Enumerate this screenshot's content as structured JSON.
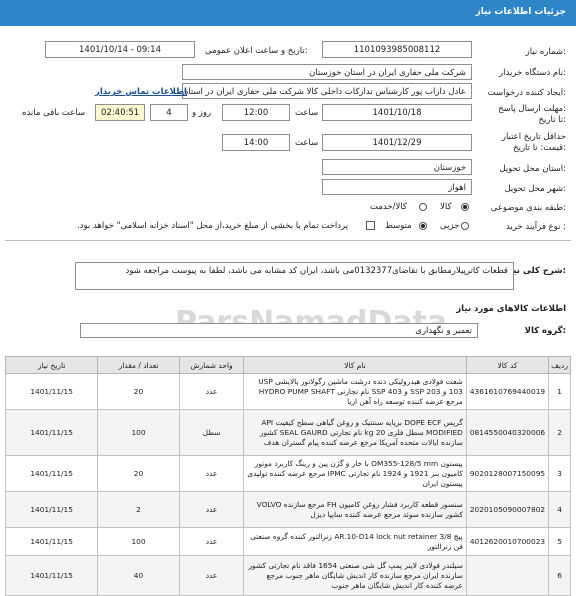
{
  "titlebar": {
    "title": "جزئیات اطلاعات نیاز"
  },
  "fields": {
    "need_number_label": "شماره نیاز:",
    "need_number": "1101093985008112",
    "announce_label": "تاریخ و ساعت اعلان عمومی:",
    "announce_value": "1401/10/14 - 09:14",
    "buyer_label": "نام دستگاه خریدار:",
    "buyer_value": "شرکت ملی حفاری ایران در استان خوزستان",
    "creator_label": "ایجاد کننده درخواست:",
    "creator_value": "عادل داراب پور کارشناس تدارکات داخلی کالا شرکت ملی حفاری ایران در استان",
    "contact_link": "اطلاعات تماس خریدار",
    "deadline_label": "مهلت ارسال پاسخ:",
    "deadline_until": "تا تاریخ:",
    "deadline_date": "1401/10/18",
    "hour_label": "ساعت",
    "deadline_time": "12:00",
    "days_value": "4",
    "days_label": "روز و",
    "remaining_time": "02:40:51",
    "remaining_label": "ساعت باقی مانده",
    "min_price_label": "حداقل تاریخ اعتبار",
    "min_price_label2": "قیمت: تا تاریخ:",
    "validity_date": "1401/12/29",
    "validity_time": "14:00",
    "province_label": "استان محل تحویل:",
    "province_value": "خوزستان",
    "city_label": "شهر محل تحویل:",
    "city_value": "اهواز",
    "category_label": "طبقه بندی موضوعی:",
    "category_opt1": "کالا",
    "category_opt2": "کالا/خدمت",
    "purchase_label": "نوع فرآیند خرید :",
    "purchase_opt1": "جزیی",
    "purchase_opt2": "متوسط",
    "purchase_note": "پرداخت تمام یا بخشی از مبلغ خرید،از محل \"اسناد خزانه اسلامی\" خواهد بود."
  },
  "summary": {
    "label": "شرح کلی نیاز:",
    "text": "قطعات کاترپیلارمطابق با تقاضای0132377می باشد، ایران کد مشابه می باشد، لطفا به پیوست مراجعه شود"
  },
  "goods_section": {
    "title": "اطلاعات کالاهای مورد نیاز",
    "group_label": "گروه کالا:",
    "group_value": "تعمیر و نگهداری"
  },
  "table": {
    "headers": [
      "ردیف",
      "کد کالا",
      "نام کالا",
      "واحد شمارش",
      "تعداد / مقدار",
      "تاریخ نیاز"
    ],
    "rows": [
      {
        "n": "1",
        "code": "4361610769440019",
        "name": "شفت فولادی هیدرولیکی دنده درشت ماشین رگولاتور پالایشی USP 103 و SSP 203 و SSP 403 نام تجارتی HYDRO PUMP SHAFT مرجع عرضه کننده توسعه راه آهن اریا",
        "unit": "عدد",
        "qty": "20",
        "date": "1401/11/15"
      },
      {
        "n": "2",
        "code": "0814550040320006",
        "name": "گریس DOPE ECF برپایه سنتتیک و روغن گیاهی سطح کیفیت API MODIFIED سطل فلزی 20 kg نام تجارتی SEAL GAURD کشور سازنده ایالات متحده آمریکا مرجع عرضه کننده پیام گستران هدف",
        "unit": "سطل",
        "qty": "100",
        "date": "1401/11/15"
      },
      {
        "n": "3",
        "code": "9020128007150095",
        "name": "پیستون OM355-128/5 mm با خار و گژن پین و رینگ کاربرد موتور کامیون بنز 1921 و 1924 نام تجارتی IPMC مرجع عرضه کننده تولیدی پیستون ایران",
        "unit": "عدد",
        "qty": "20",
        "date": "1401/11/15"
      },
      {
        "n": "4",
        "code": "2020105090007802",
        "name": "سنسور قطعه کاربرد فشار روغن کامیون FH مرجع سازنده VOLVO کشور سازنده سوئد مرجع عرضه کننده سایپا دیزل",
        "unit": "عدد",
        "qty": "2",
        "date": "1401/11/15"
      },
      {
        "n": "5",
        "code": "4012620010700023",
        "name": "پیچ AR.10-D14 lock nut retainer 3/8 زنرالتور کننده گروه صنعتی فن زنرالتور",
        "unit": "عدد",
        "qty": "100",
        "date": "1401/11/15"
      },
      {
        "n": "6",
        "code": "",
        "name": "سیلندر فولادی لاینر پمپ گل شی صنعتی 1654 فاقد نام تجارتی کشور سازنده ایران مرجع سازنده کار اندیش شایگان ماهر جنوب مرجع عرضه کننده کار اندیش شایگان ماهر جنوب",
        "unit": "عدد",
        "qty": "40",
        "date": "1401/11/15"
      }
    ]
  },
  "watermarks": [
    "ParsNamadData",
    "پارس نماد داده"
  ]
}
